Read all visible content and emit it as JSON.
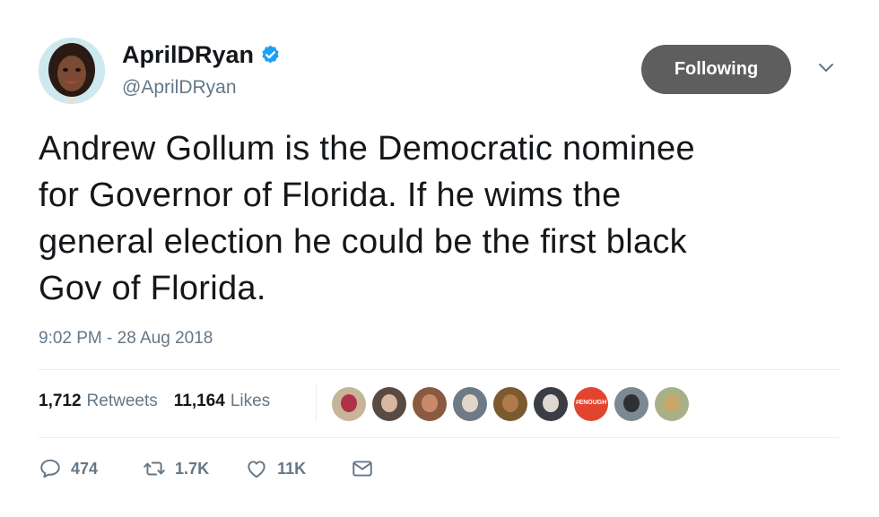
{
  "author": {
    "display_name": "AprilDRyan",
    "handle": "@AprilDRyan",
    "verified": true
  },
  "follow_button": {
    "label": "Following"
  },
  "tweet": {
    "lines": [
      "Andrew Gollum is the Democratic nominee",
      "for Governor of Florida. If he wims the",
      "general election he could be the first black",
      "Gov of Florida."
    ],
    "timestamp": "9:02 PM - 28 Aug 2018"
  },
  "stats": {
    "retweets_count": "1,712",
    "retweets_label": "Retweets",
    "likes_count": "11,164",
    "likes_label": "Likes"
  },
  "likers": [
    {
      "bg": "#c7b59a",
      "face": "#b0304a"
    },
    {
      "bg": "#5a4a44",
      "face": "#d8b8a4"
    },
    {
      "bg": "#8a5a40",
      "face": "#c98a6a"
    },
    {
      "bg": "#6e7a86",
      "face": "#e2d6c8"
    },
    {
      "bg": "#7a5a2e",
      "face": "#b07a4a"
    },
    {
      "bg": "#3a3d44",
      "face": "#ded8d2"
    },
    {
      "bg": "#e2452f",
      "face": "#e2452f",
      "badge": "#ENOUGH"
    },
    {
      "bg": "#7a8a90",
      "face": "#2e3034"
    },
    {
      "bg": "#a8b088",
      "face": "#c7a86a"
    }
  ],
  "actions": {
    "reply_count": "474",
    "retweet_count": "1.7K",
    "like_count": "11K"
  },
  "colors": {
    "verified_blue": "#1da1f2",
    "secondary_text": "#657786",
    "follow_bg": "#5e5e5e"
  }
}
